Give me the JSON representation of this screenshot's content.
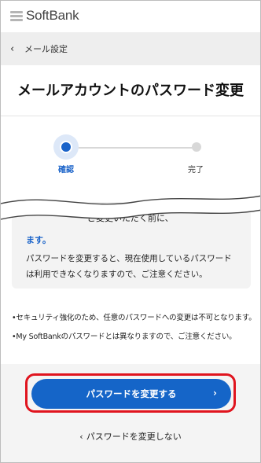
{
  "brand": {
    "logo_text": "SoftBank"
  },
  "breadcrumb": {
    "label": "メール設定"
  },
  "page": {
    "title": "メールアカウントのパスワード変更"
  },
  "stepper": {
    "steps": [
      {
        "label": "確認",
        "state": "current"
      },
      {
        "label": "完了",
        "state": "upcoming"
      }
    ]
  },
  "notice": {
    "line0": "ご変更いただく前に、",
    "line1": "ます。",
    "line2": "パスワードを変更すると、現在使用しているパスワード",
    "line3": "は利用できなくなりますので、ご注意ください。"
  },
  "bullets": [
    "•セキュリティ強化のため、任意のパスワードへの変更は不可となります。",
    "•My SoftBankのパスワードとは異なりますので、ご注意ください。"
  ],
  "actions": {
    "primary_label": "パスワードを変更する",
    "secondary_label": "パスワードを変更しない"
  },
  "colors": {
    "accent": "#1565c8",
    "highlight_outline": "#e0141e"
  }
}
